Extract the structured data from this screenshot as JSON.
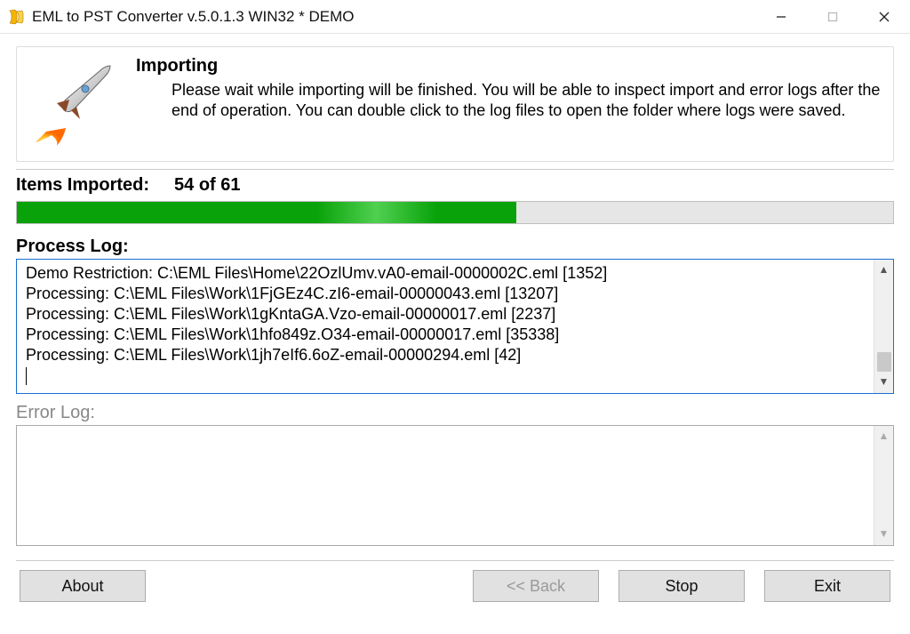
{
  "window": {
    "title": "EML to PST Converter v.5.0.1.3 WIN32 * DEMO"
  },
  "banner": {
    "heading": "Importing",
    "description": "Please wait while importing will be finished. You will be able to inspect import and error logs after the end of operation. You can double click to the log files to open the folder where logs were saved."
  },
  "progress": {
    "items_label": "Items Imported:",
    "items_value": "54 of 61",
    "percent": 57
  },
  "process_log": {
    "label": "Process Log:",
    "lines": [
      "Demo Restriction: C:\\EML Files\\Home\\22OzlUmv.vA0-email-0000002C.eml [1352]",
      "Processing: C:\\EML Files\\Work\\1FjGEz4C.zI6-email-00000043.eml [13207]",
      "Processing: C:\\EML Files\\Work\\1gKntaGA.Vzo-email-00000017.eml [2237]",
      "Processing: C:\\EML Files\\Work\\1hfo849z.O34-email-00000017.eml [35338]",
      "Processing: C:\\EML Files\\Work\\1jh7eIf6.6oZ-email-00000294.eml [42]"
    ]
  },
  "error_log": {
    "label": "Error Log:",
    "lines": []
  },
  "buttons": {
    "about": "About",
    "back": "<< Back",
    "stop": "Stop",
    "exit": "Exit"
  }
}
